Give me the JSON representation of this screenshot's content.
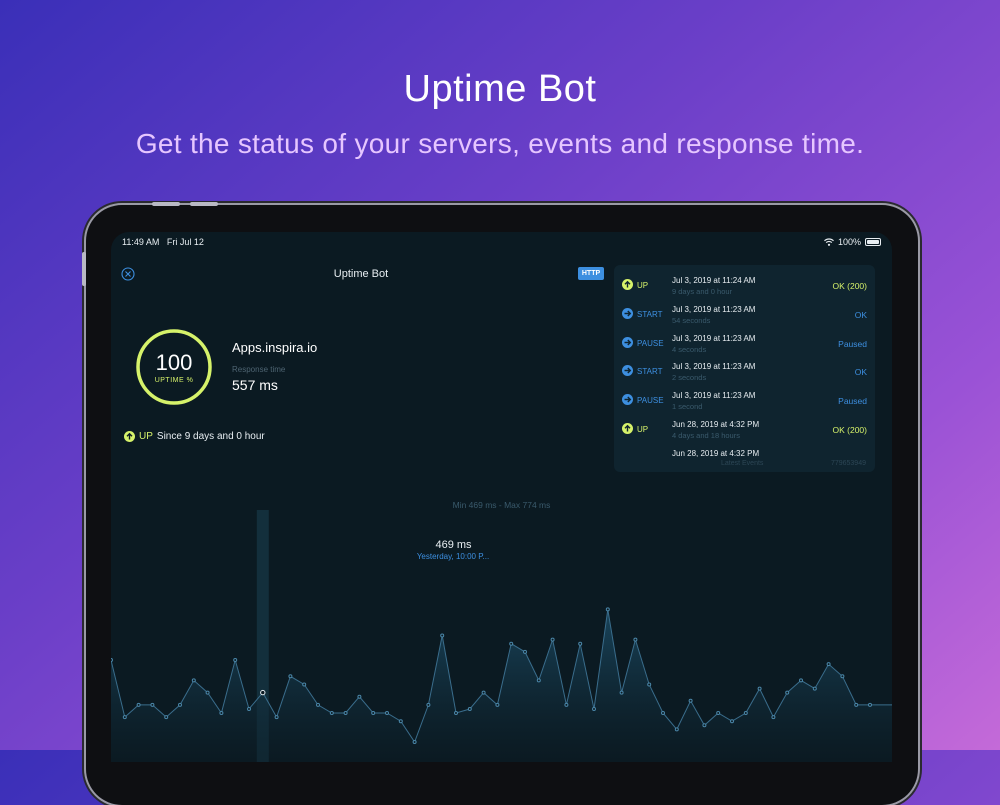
{
  "hero": {
    "title": "Uptime Bot",
    "subtitle": "Get the status of your servers, events and response time."
  },
  "statusbar": {
    "time": "11:49 AM",
    "date": "Fri Jul 12",
    "battery": "100%"
  },
  "nav": {
    "title": "Uptime Bot",
    "badge": "HTTP"
  },
  "monitor": {
    "uptime_value": "100",
    "uptime_label": "UPTIME %",
    "uptime_percent": 100,
    "name": "Apps.inspira.io",
    "response_label": "Response time",
    "response_value": "557 ms",
    "status_word": "UP",
    "status_since": "Since 9 days and 0 hour"
  },
  "events": {
    "items": [
      {
        "type": "UP",
        "date": "Jul 3, 2019 at 11:24 AM",
        "duration": "9 days and 0 hour",
        "status": "OK (200)",
        "kind": "up"
      },
      {
        "type": "START",
        "date": "Jul 3, 2019 at 11:23 AM",
        "duration": "54 seconds",
        "status": "OK",
        "kind": "start"
      },
      {
        "type": "PAUSE",
        "date": "Jul 3, 2019 at 11:23 AM",
        "duration": "4 seconds",
        "status": "Paused",
        "kind": "pause"
      },
      {
        "type": "START",
        "date": "Jul 3, 2019 at 11:23 AM",
        "duration": "2 seconds",
        "status": "OK",
        "kind": "start"
      },
      {
        "type": "PAUSE",
        "date": "Jul 3, 2019 at 11:23 AM",
        "duration": "1 second",
        "status": "Paused",
        "kind": "pause"
      },
      {
        "type": "UP",
        "date": "Jun 28, 2019 at 4:32 PM",
        "duration": "4 days and 18 hours",
        "status": "OK (200)",
        "kind": "up"
      },
      {
        "type": "",
        "date": "Jun 28, 2019 at 4:32 PM",
        "duration": "",
        "status": "",
        "kind": "partial"
      }
    ],
    "footer_label": "Latest Events",
    "footer_id": "779653949"
  },
  "chart_data": {
    "type": "area",
    "title": "Min 469 ms - Max 774 ms",
    "unit": "ms",
    "ylim": [
      469,
      774
    ],
    "selected_index": 11,
    "tooltip_value": "469 ms",
    "tooltip_time": "Yesterday, 10:00 P...",
    "values": [
      670,
      530,
      560,
      560,
      530,
      560,
      620,
      590,
      540,
      670,
      550,
      590,
      530,
      630,
      610,
      560,
      540,
      540,
      580,
      540,
      540,
      520,
      469,
      560,
      730,
      540,
      550,
      590,
      560,
      710,
      690,
      620,
      720,
      560,
      710,
      550,
      794,
      590,
      720,
      610,
      540,
      500,
      570,
      510,
      540,
      520,
      540,
      600,
      530,
      590,
      620,
      600,
      660,
      630,
      560,
      560
    ]
  },
  "colors": {
    "up": "#d6f26a",
    "start": "#3d8fe0",
    "pause": "#3d8fe0",
    "accent": "#3d8fe0",
    "chart_line": "#3a6d8c",
    "chart_fill": "#1b4a63"
  }
}
